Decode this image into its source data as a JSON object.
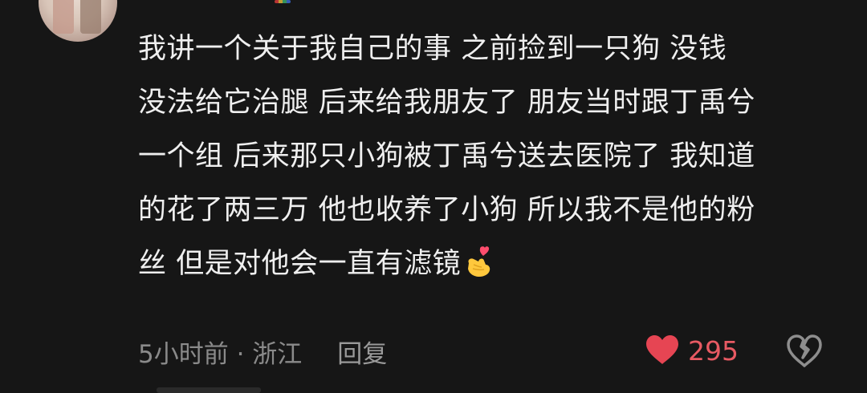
{
  "comment": {
    "lines": [
      "我讲一个关于我自己的事 之前捡到一只狗 没钱",
      "没法给它治腿 后来给我朋友了 朋友当时跟丁禹兮",
      "一个组 后来那只小狗被丁禹兮送去医院了 我知道",
      "的花了两三万 他也收养了小狗 所以我不是他的粉",
      "丝 但是对他会一直有滤镜"
    ],
    "emoji": "heart-hand-emoji",
    "time_location": "5小时前 · 浙江",
    "reply_label": "回复",
    "like_count": "295",
    "liked": true
  },
  "colors": {
    "background": "#161616",
    "text": "#efefef",
    "meta": "#8a8a8a",
    "like": "#e85a63"
  },
  "icons": {
    "like": "heart-icon",
    "dislike": "broken-heart-icon"
  }
}
